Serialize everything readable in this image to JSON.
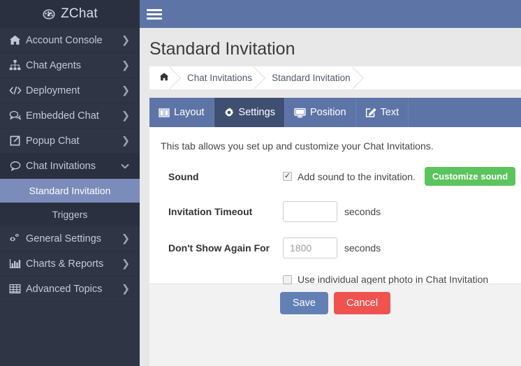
{
  "brand": {
    "name": "ZChat",
    "icon": "tachometer-icon"
  },
  "sidebar": {
    "items": [
      {
        "label": "Account Console",
        "icon": "home-icon",
        "caret": "❯"
      },
      {
        "label": "Chat Agents",
        "icon": "sitemap-icon",
        "caret": "❯"
      },
      {
        "label": "Deployment",
        "icon": "code-icon",
        "caret": "❯"
      },
      {
        "label": "Embedded Chat",
        "icon": "comments-icon",
        "caret": "❯"
      },
      {
        "label": "Popup Chat",
        "icon": "external-link-icon",
        "caret": "❯"
      },
      {
        "label": "Chat Invitations",
        "icon": "comment-icon",
        "caret": "⌄"
      }
    ],
    "subitems": [
      {
        "label": "Standard Invitation",
        "active": true
      },
      {
        "label": "Triggers",
        "active": false
      }
    ],
    "items_after": [
      {
        "label": "General Settings",
        "icon": "gears-icon",
        "caret": "❯"
      },
      {
        "label": "Charts & Reports",
        "icon": "bar-chart-icon",
        "caret": "❯"
      },
      {
        "label": "Advanced Topics",
        "icon": "table-icon",
        "caret": "❯"
      }
    ]
  },
  "topbar": {
    "menu_icon": "hamburger-icon"
  },
  "page": {
    "title": "Standard Invitation",
    "breadcrumb": [
      {
        "label": "",
        "icon": "home-icon"
      },
      {
        "label": "Chat Invitations",
        "icon": ""
      },
      {
        "label": "Standard Invitation",
        "icon": ""
      }
    ]
  },
  "tabs": [
    {
      "label": "Layout",
      "icon": "columns-icon",
      "active": false
    },
    {
      "label": "Settings",
      "icon": "gear-icon",
      "active": true
    },
    {
      "label": "Position",
      "icon": "desktop-icon",
      "active": false
    },
    {
      "label": "Text",
      "icon": "pencil-square-icon",
      "active": false
    }
  ],
  "form": {
    "intro": "This tab allows you set up and customize your Chat Invitations.",
    "sound": {
      "label": "Sound",
      "checkbox_checked": true,
      "checkbox_label": "Add sound to the invitation.",
      "customize_button": "Customize sound"
    },
    "invitation_timeout": {
      "label": "Invitation Timeout",
      "value": "",
      "placeholder": "",
      "unit": "seconds"
    },
    "dont_show_again": {
      "label": "Don't Show Again For",
      "value": "",
      "placeholder": "1800",
      "unit": "seconds"
    },
    "agent_photo": {
      "checkbox_checked": false,
      "checkbox_label": "Use individual agent photo in Chat Invitation"
    }
  },
  "footer": {
    "save_label": "Save",
    "cancel_label": "Cancel"
  },
  "colors": {
    "sidebar_bg": "#2f3545",
    "sidebar_active": "#7b8cba",
    "topbar_blue": "#5d74a6",
    "tab_active": "#3f4f71",
    "green": "#5cc45e",
    "save_blue": "#6280b5",
    "cancel_red": "#ef5350",
    "page_bg": "#e8e8e8"
  }
}
